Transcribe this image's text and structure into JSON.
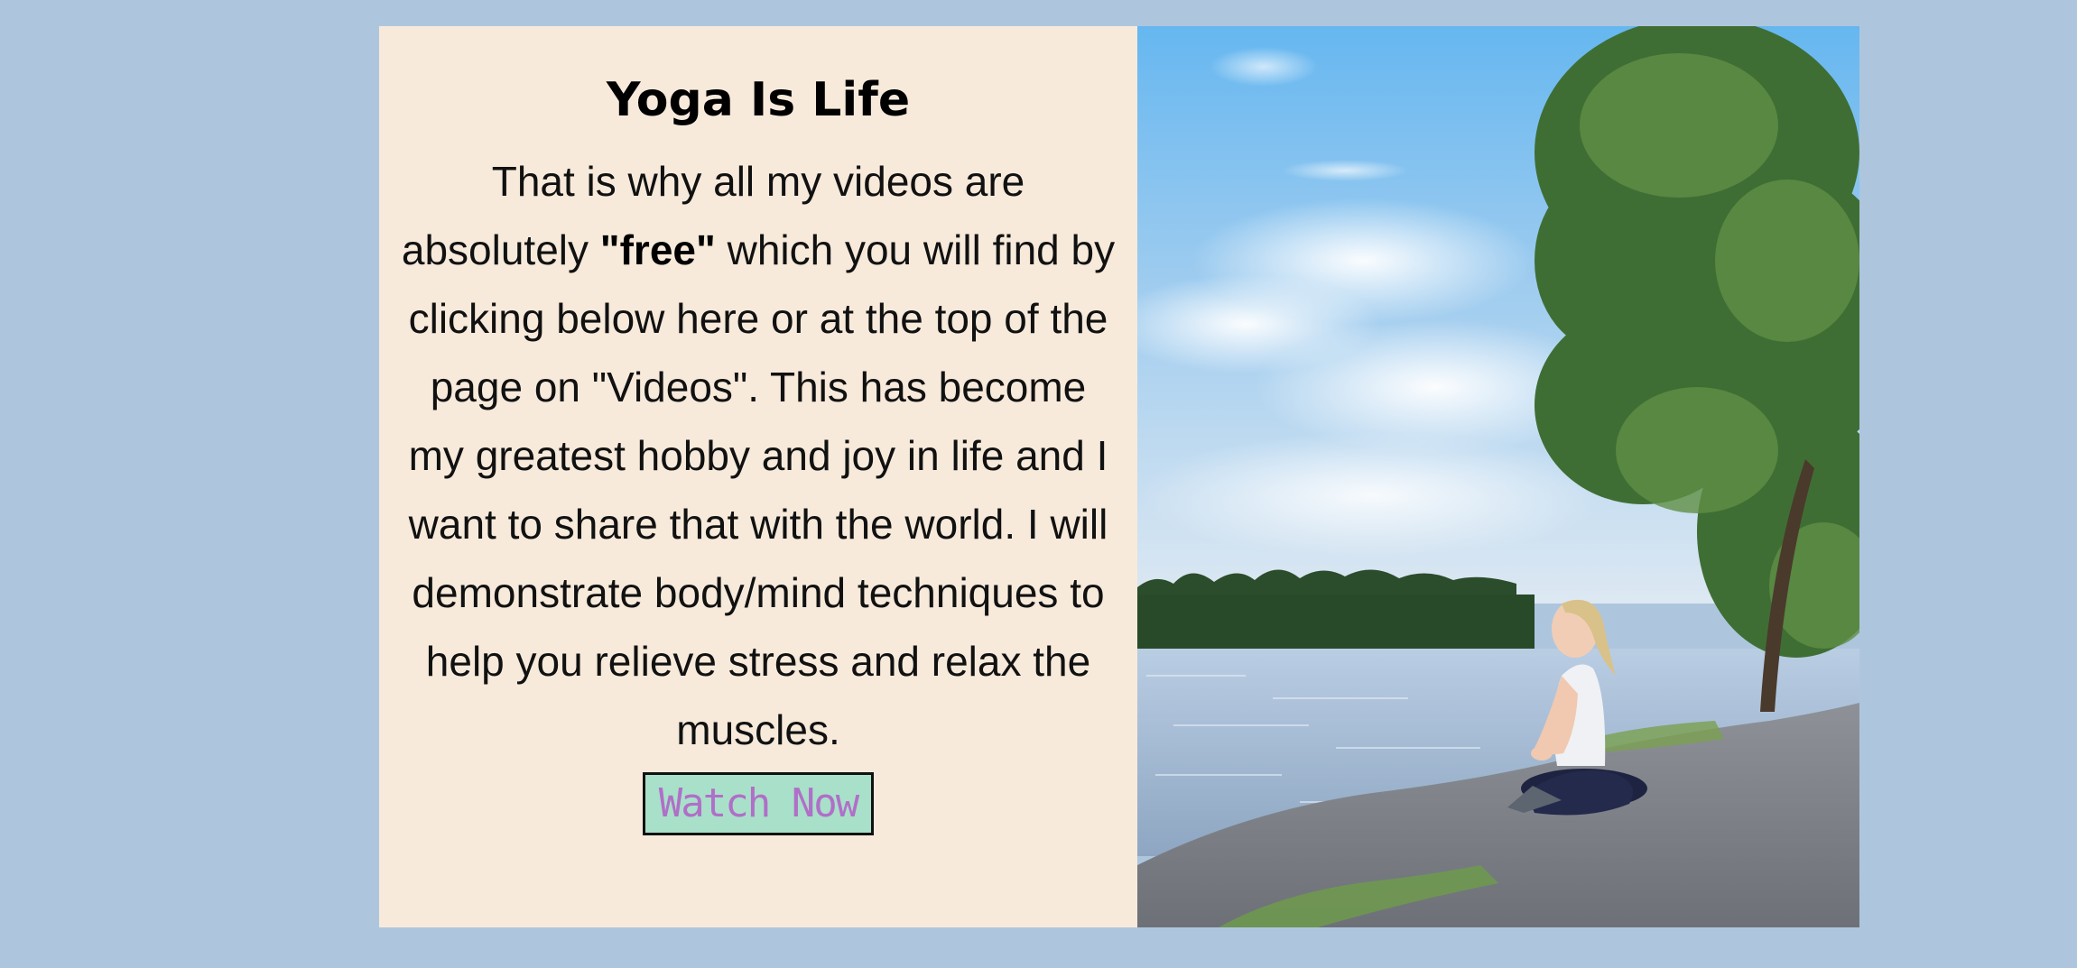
{
  "section": {
    "title": "Yoga Is Life",
    "body_before": "That is why all my videos are absolutely ",
    "body_bold": "\"free\"",
    "body_after": " which you will find by clicking below here or at the top of the page on \"Videos\". This has become my greatest hobby and joy in life and I want to share that with the world. I will demonstrate body/mind techniques to help you relieve stress and relax the muscles.",
    "button_label": "Watch Now"
  },
  "colors": {
    "page_background": "#adc6de",
    "text_panel_background": "#f7eadb",
    "button_background": "#a9e0c9",
    "button_text": "#b06fc8"
  },
  "photo": {
    "subject": "woman-meditating-by-lake-icon"
  }
}
